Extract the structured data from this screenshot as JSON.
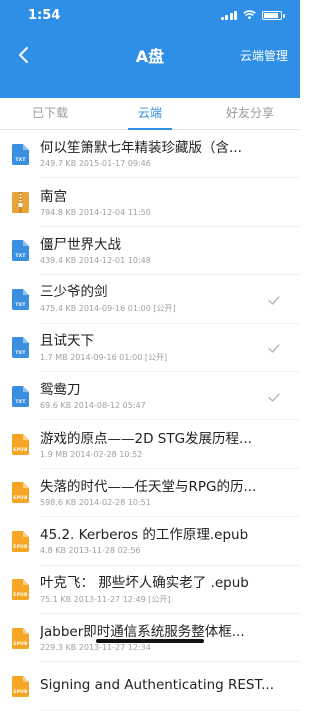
{
  "status_bar": {
    "time": "1:54"
  },
  "nav": {
    "title": "A盘",
    "manage_label": "云端管理"
  },
  "tabs": [
    {
      "label": "已下载",
      "active": false
    },
    {
      "label": "云端",
      "active": true
    },
    {
      "label": "好友分享",
      "active": false
    }
  ],
  "colors": {
    "accent": "#2f8fe6",
    "txt_icon": "#3a8fe0",
    "epub_icon": "#f5a623",
    "zip_icon": "#e8a33a"
  },
  "files": [
    {
      "name": "何以笙箫默七年精装珍藏版（含...",
      "size": "249.7 KB",
      "date": "2015-01-17 09:46",
      "public": "",
      "type": "TXT",
      "icon": "txt-file-icon",
      "downloaded": false
    },
    {
      "name": "南宫",
      "size": "794.8 KB",
      "date": "2014-12-04 11:50",
      "public": "",
      "type": "ZIP",
      "icon": "zip-file-icon",
      "downloaded": false
    },
    {
      "name": "僵尸世界大战",
      "size": "439.4 KB",
      "date": "2014-12-01 10:48",
      "public": "",
      "type": "TXT",
      "icon": "txt-file-icon",
      "downloaded": false
    },
    {
      "name": "三少爷的剑",
      "size": "475.4 KB",
      "date": "2014-09-16 01:00",
      "public": "[公开]",
      "type": "TXT",
      "icon": "txt-file-icon",
      "downloaded": true
    },
    {
      "name": "且试天下",
      "size": "1.7 MB",
      "date": "2014-09-16 01:00",
      "public": "[公开]",
      "type": "TXT",
      "icon": "txt-file-icon",
      "downloaded": true
    },
    {
      "name": "鸳鸯刀",
      "size": "69.6 KB",
      "date": "2014-08-12 05:47",
      "public": "",
      "type": "TXT",
      "icon": "txt-file-icon",
      "downloaded": true
    },
    {
      "name": "游戏的原点——2D STG发展历程...",
      "size": "1.9 MB",
      "date": "2014-02-28 10:52",
      "public": "",
      "type": "EPUB",
      "icon": "epub-file-icon",
      "downloaded": false
    },
    {
      "name": "失落的时代——任天堂与RPG的历...",
      "size": "598.6 KB",
      "date": "2014-02-28 10:51",
      "public": "",
      "type": "EPUB",
      "icon": "epub-file-icon",
      "downloaded": false
    },
    {
      "name": "45.2. Kerberos 的工作原理.epub",
      "size": "4.8 KB",
      "date": "2013-11-28 02:56",
      "public": "",
      "type": "EPUB",
      "icon": "epub-file-icon",
      "downloaded": false
    },
    {
      "name": "叶克飞： 那些坏人确实老了 .epub",
      "size": "75.1 KB",
      "date": "2013-11-27 12:49",
      "public": "[公开]",
      "type": "EPUB",
      "icon": "epub-file-icon",
      "downloaded": false
    },
    {
      "name": "Jabber即时通信系统服务整体框...",
      "size": "229.3 KB",
      "date": "2013-11-27 12:34",
      "public": "",
      "type": "EPUB",
      "icon": "epub-file-icon",
      "downloaded": false
    },
    {
      "name": "Signing and Authenticating REST...",
      "size": "",
      "date": "",
      "public": "",
      "type": "EPUB",
      "icon": "epub-file-icon",
      "downloaded": false
    }
  ]
}
